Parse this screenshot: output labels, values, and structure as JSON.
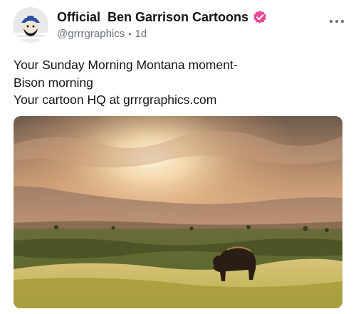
{
  "post": {
    "author": {
      "display_name": "Official  Ben Garrison Cartoons",
      "handle": "@grrrgraphics",
      "time_ago": "1d",
      "separator": "•",
      "verified": true,
      "verified_badge_color": "#ec4899"
    },
    "text_lines": [
      "Your Sunday Morning Montana moment-",
      "Bison morning",
      "Your cartoon HQ at grrrgraphics.com"
    ],
    "more_icon": "ellipsis-horizontal-icon",
    "media": {
      "kind": "photo"
    }
  },
  "colors": {
    "text": "#0f1419",
    "muted": "#6b7280",
    "accent": "#ec4899"
  }
}
